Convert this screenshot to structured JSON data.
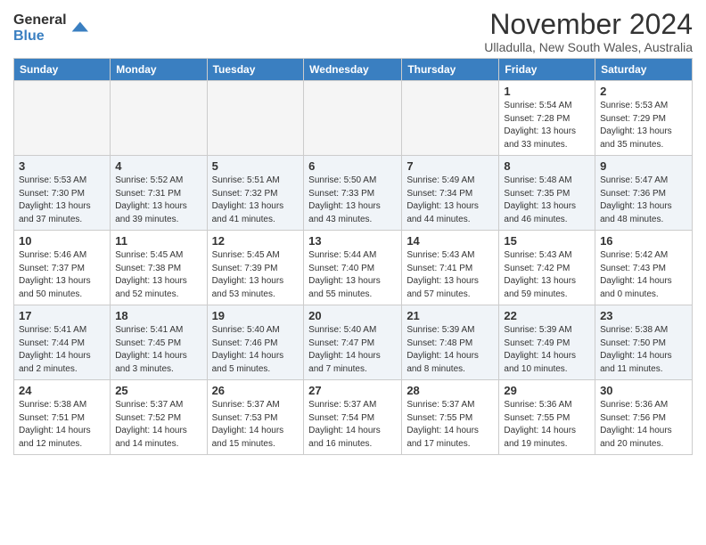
{
  "header": {
    "logo_general": "General",
    "logo_blue": "Blue",
    "month_title": "November 2024",
    "location": "Ulladulla, New South Wales, Australia"
  },
  "calendar": {
    "days_of_week": [
      "Sunday",
      "Monday",
      "Tuesday",
      "Wednesday",
      "Thursday",
      "Friday",
      "Saturday"
    ],
    "weeks": [
      [
        {
          "day": "",
          "info": ""
        },
        {
          "day": "",
          "info": ""
        },
        {
          "day": "",
          "info": ""
        },
        {
          "day": "",
          "info": ""
        },
        {
          "day": "",
          "info": ""
        },
        {
          "day": "1",
          "info": "Sunrise: 5:54 AM\nSunset: 7:28 PM\nDaylight: 13 hours\nand 33 minutes."
        },
        {
          "day": "2",
          "info": "Sunrise: 5:53 AM\nSunset: 7:29 PM\nDaylight: 13 hours\nand 35 minutes."
        }
      ],
      [
        {
          "day": "3",
          "info": "Sunrise: 5:53 AM\nSunset: 7:30 PM\nDaylight: 13 hours\nand 37 minutes."
        },
        {
          "day": "4",
          "info": "Sunrise: 5:52 AM\nSunset: 7:31 PM\nDaylight: 13 hours\nand 39 minutes."
        },
        {
          "day": "5",
          "info": "Sunrise: 5:51 AM\nSunset: 7:32 PM\nDaylight: 13 hours\nand 41 minutes."
        },
        {
          "day": "6",
          "info": "Sunrise: 5:50 AM\nSunset: 7:33 PM\nDaylight: 13 hours\nand 43 minutes."
        },
        {
          "day": "7",
          "info": "Sunrise: 5:49 AM\nSunset: 7:34 PM\nDaylight: 13 hours\nand 44 minutes."
        },
        {
          "day": "8",
          "info": "Sunrise: 5:48 AM\nSunset: 7:35 PM\nDaylight: 13 hours\nand 46 minutes."
        },
        {
          "day": "9",
          "info": "Sunrise: 5:47 AM\nSunset: 7:36 PM\nDaylight: 13 hours\nand 48 minutes."
        }
      ],
      [
        {
          "day": "10",
          "info": "Sunrise: 5:46 AM\nSunset: 7:37 PM\nDaylight: 13 hours\nand 50 minutes."
        },
        {
          "day": "11",
          "info": "Sunrise: 5:45 AM\nSunset: 7:38 PM\nDaylight: 13 hours\nand 52 minutes."
        },
        {
          "day": "12",
          "info": "Sunrise: 5:45 AM\nSunset: 7:39 PM\nDaylight: 13 hours\nand 53 minutes."
        },
        {
          "day": "13",
          "info": "Sunrise: 5:44 AM\nSunset: 7:40 PM\nDaylight: 13 hours\nand 55 minutes."
        },
        {
          "day": "14",
          "info": "Sunrise: 5:43 AM\nSunset: 7:41 PM\nDaylight: 13 hours\nand 57 minutes."
        },
        {
          "day": "15",
          "info": "Sunrise: 5:43 AM\nSunset: 7:42 PM\nDaylight: 13 hours\nand 59 minutes."
        },
        {
          "day": "16",
          "info": "Sunrise: 5:42 AM\nSunset: 7:43 PM\nDaylight: 14 hours\nand 0 minutes."
        }
      ],
      [
        {
          "day": "17",
          "info": "Sunrise: 5:41 AM\nSunset: 7:44 PM\nDaylight: 14 hours\nand 2 minutes."
        },
        {
          "day": "18",
          "info": "Sunrise: 5:41 AM\nSunset: 7:45 PM\nDaylight: 14 hours\nand 3 minutes."
        },
        {
          "day": "19",
          "info": "Sunrise: 5:40 AM\nSunset: 7:46 PM\nDaylight: 14 hours\nand 5 minutes."
        },
        {
          "day": "20",
          "info": "Sunrise: 5:40 AM\nSunset: 7:47 PM\nDaylight: 14 hours\nand 7 minutes."
        },
        {
          "day": "21",
          "info": "Sunrise: 5:39 AM\nSunset: 7:48 PM\nDaylight: 14 hours\nand 8 minutes."
        },
        {
          "day": "22",
          "info": "Sunrise: 5:39 AM\nSunset: 7:49 PM\nDaylight: 14 hours\nand 10 minutes."
        },
        {
          "day": "23",
          "info": "Sunrise: 5:38 AM\nSunset: 7:50 PM\nDaylight: 14 hours\nand 11 minutes."
        }
      ],
      [
        {
          "day": "24",
          "info": "Sunrise: 5:38 AM\nSunset: 7:51 PM\nDaylight: 14 hours\nand 12 minutes."
        },
        {
          "day": "25",
          "info": "Sunrise: 5:37 AM\nSunset: 7:52 PM\nDaylight: 14 hours\nand 14 minutes."
        },
        {
          "day": "26",
          "info": "Sunrise: 5:37 AM\nSunset: 7:53 PM\nDaylight: 14 hours\nand 15 minutes."
        },
        {
          "day": "27",
          "info": "Sunrise: 5:37 AM\nSunset: 7:54 PM\nDaylight: 14 hours\nand 16 minutes."
        },
        {
          "day": "28",
          "info": "Sunrise: 5:37 AM\nSunset: 7:55 PM\nDaylight: 14 hours\nand 17 minutes."
        },
        {
          "day": "29",
          "info": "Sunrise: 5:36 AM\nSunset: 7:55 PM\nDaylight: 14 hours\nand 19 minutes."
        },
        {
          "day": "30",
          "info": "Sunrise: 5:36 AM\nSunset: 7:56 PM\nDaylight: 14 hours\nand 20 minutes."
        }
      ]
    ]
  }
}
